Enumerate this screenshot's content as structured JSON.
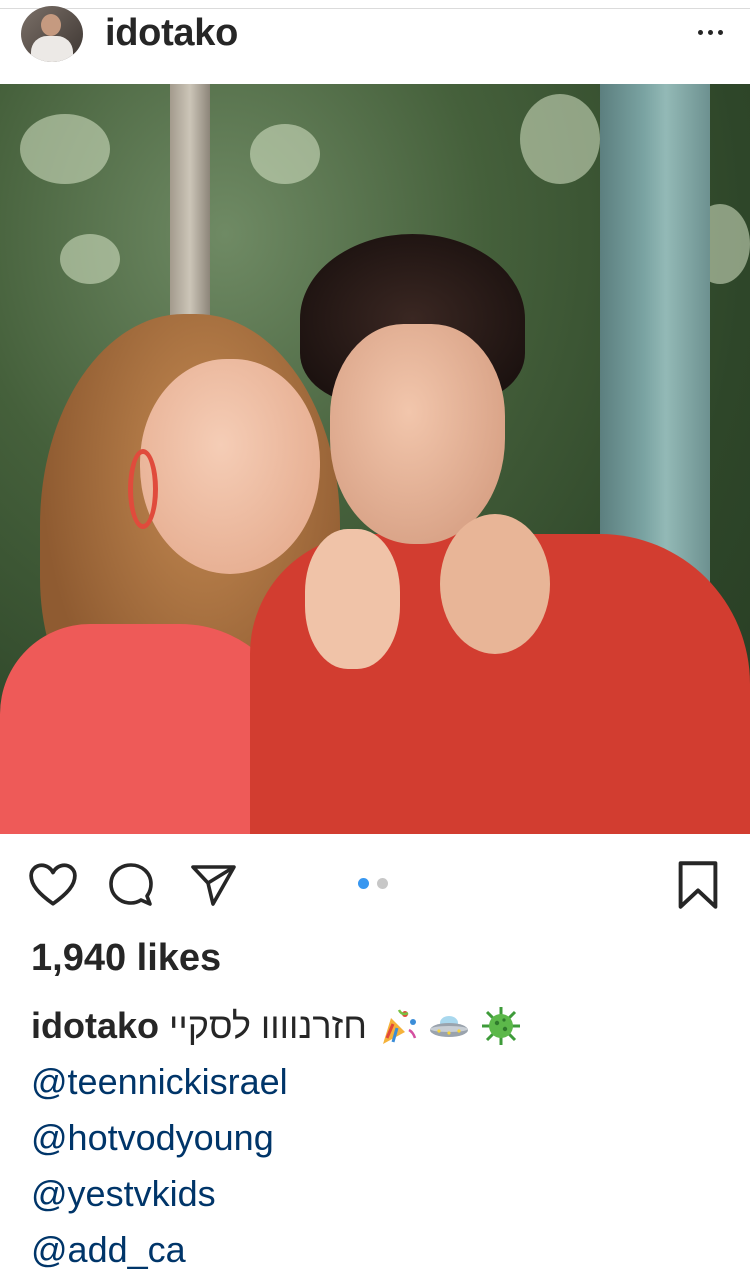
{
  "post": {
    "username": "idotako",
    "likes": "1,940 likes",
    "caption": {
      "username": "idotako",
      "text": "חזרנוווו לסקיי",
      "emojis": [
        "party-popper-emoji",
        "ufo-emoji",
        "virus-emoji"
      ]
    },
    "mentions": [
      "@teennickisrael",
      "@hotvodyoung",
      "@yestvkids",
      "@add_ca"
    ],
    "carousel": {
      "total": 2,
      "active_index": 0
    }
  },
  "colors": {
    "text": "#262626",
    "mention": "#003569",
    "active_dot": "#3897f0",
    "inactive_dot": "#c7c7c7"
  },
  "icons": {
    "like": "heart-icon",
    "comment": "comment-icon",
    "share": "paper-plane-icon",
    "save": "bookmark-icon",
    "more": "more-options-icon"
  }
}
